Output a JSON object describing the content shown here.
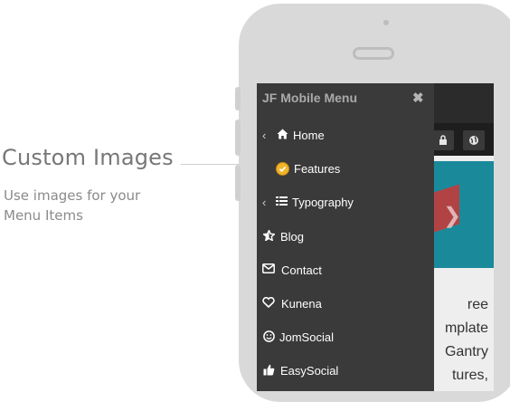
{
  "callout": {
    "title": "Custom Images",
    "subtitle": "Use images for your Menu Items"
  },
  "menu": {
    "title": "JF Mobile Menu",
    "close_icon": "close-icon",
    "items": [
      {
        "label": "Home",
        "icon": "home-icon",
        "has_submenu": true
      },
      {
        "label": "Features",
        "icon": "custom-badge-image",
        "has_submenu": false
      },
      {
        "label": "Typography",
        "icon": "list-icon",
        "has_submenu": true
      },
      {
        "label": "Blog",
        "icon": "star-icon",
        "has_submenu": false
      },
      {
        "label": "Contact",
        "icon": "envelope-icon",
        "has_submenu": false
      },
      {
        "label": "Kunena",
        "icon": "heart-icon",
        "has_submenu": false
      },
      {
        "label": "JomSocial",
        "icon": "smile-icon",
        "has_submenu": false
      },
      {
        "label": "EasySocial",
        "icon": "thumbs-up-icon",
        "has_submenu": false
      }
    ]
  },
  "site_preview": {
    "text_lines": [
      "ree",
      "mplate",
      "Gantry",
      "tures,"
    ],
    "accent_color": "#1a8a9b"
  }
}
